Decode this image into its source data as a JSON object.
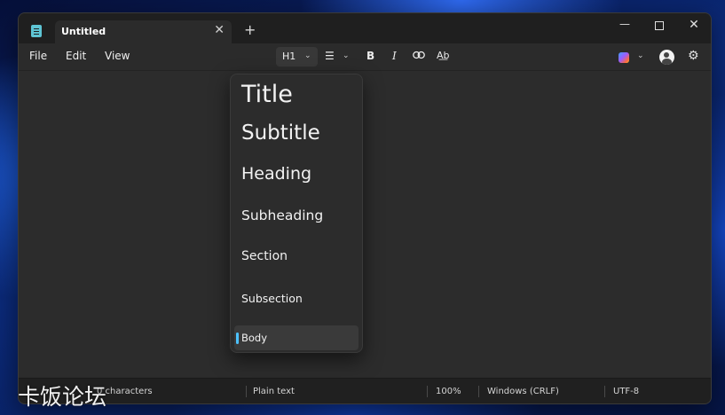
{
  "window": {
    "tab_title": "Untitled",
    "tab_close": "✕",
    "new_tab": "+"
  },
  "window_controls": {
    "minimize": "—",
    "close": "✕"
  },
  "menu": {
    "file": "File",
    "edit": "Edit",
    "view": "View"
  },
  "toolbar": {
    "heading_value": "H1",
    "list_icon": "bulleted-list-icon",
    "bold": "B",
    "italic": "I",
    "link_icon": "link-icon",
    "spellcheck": "A͟b",
    "copilot_icon": "copilot-icon",
    "account_icon": "account-icon",
    "settings_icon": "gear-icon"
  },
  "heading_dropdown": {
    "items": [
      {
        "label": "Title"
      },
      {
        "label": "Subtitle"
      },
      {
        "label": "Heading"
      },
      {
        "label": "Subheading"
      },
      {
        "label": "Section"
      },
      {
        "label": "Subsection"
      },
      {
        "label": "Body",
        "selected": true
      }
    ],
    "selected_color": "#4cc2ff"
  },
  "statusbar": {
    "characters": "0 characters",
    "format": "Plain text",
    "zoom": "100%",
    "line_ending": "Windows (CRLF)",
    "encoding": "UTF-8"
  },
  "watermark": "卡饭论坛"
}
